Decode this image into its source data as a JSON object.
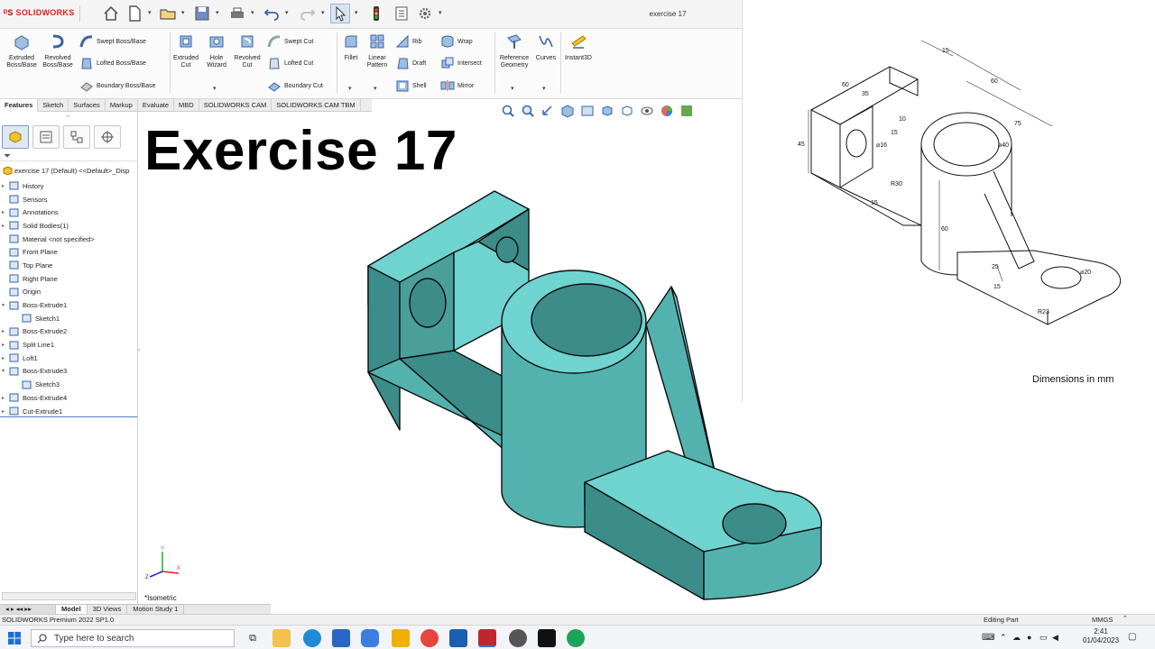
{
  "app": {
    "logo": "SOLIDWORKS",
    "doc_title": "exercise 17"
  },
  "ribbon": {
    "features": [
      {
        "label": "Extruded\nBoss/Base",
        "icon": "extruded-boss-icon"
      },
      {
        "label": "Revolved\nBoss/Base",
        "icon": "revolved-boss-icon"
      },
      {
        "label": "Extruded\nCut",
        "icon": "extruded-cut-icon"
      },
      {
        "label": "Hole\nWizard",
        "icon": "hole-wizard-icon"
      },
      {
        "label": "Revolved\nCut",
        "icon": "revolved-cut-icon"
      },
      {
        "label": "Fillet",
        "icon": "fillet-icon"
      },
      {
        "label": "Linear\nPattern",
        "icon": "linear-pattern-icon"
      },
      {
        "label": "Reference\nGeometry",
        "icon": "reference-geometry-icon"
      },
      {
        "label": "Curves",
        "icon": "curves-icon"
      },
      {
        "label": "Instant3D",
        "icon": "instant3d-icon"
      }
    ],
    "small": {
      "swept_boss": "Swept Boss/Base",
      "lofted_boss": "Lofted Boss/Base",
      "boundary_boss": "Boundary Boss/Base",
      "swept_cut": "Swept Cut",
      "lofted_cut": "Lofted Cut",
      "boundary_cut": "Boundary Cut",
      "rib": "Rib",
      "draft": "Draft",
      "shell": "Shell",
      "wrap": "Wrap",
      "intersect": "Intersect",
      "mirror": "Mirror"
    }
  },
  "tabs": [
    "Features",
    "Sketch",
    "Surfaces",
    "Markup",
    "Evaluate",
    "MBD",
    "SOLIDWORKS CAM",
    "SOLIDWORKS CAM TBM"
  ],
  "tree": {
    "root": "exercise 17 (Default) <<Default>_Disp",
    "items": [
      {
        "label": "History",
        "exp": "▸",
        "indent": 0
      },
      {
        "label": "Sensors",
        "exp": "",
        "indent": 0
      },
      {
        "label": "Annotations",
        "exp": "▸",
        "indent": 0
      },
      {
        "label": "Solid Bodies(1)",
        "exp": "▸",
        "indent": 0
      },
      {
        "label": "Material <not specified>",
        "exp": "",
        "indent": 0
      },
      {
        "label": "Front Plane",
        "exp": "",
        "indent": 0
      },
      {
        "label": "Top Plane",
        "exp": "",
        "indent": 0
      },
      {
        "label": "Right Plane",
        "exp": "",
        "indent": 0
      },
      {
        "label": "Origin",
        "exp": "",
        "indent": 0
      },
      {
        "label": "Boss-Extrude1",
        "exp": "▾",
        "indent": 0
      },
      {
        "label": "Sketch1",
        "exp": "",
        "indent": 1
      },
      {
        "label": "Boss-Extrude2",
        "exp": "▸",
        "indent": 0
      },
      {
        "label": "Split Line1",
        "exp": "▸",
        "indent": 0
      },
      {
        "label": "Loft1",
        "exp": "▸",
        "indent": 0
      },
      {
        "label": "Boss-Extrude3",
        "exp": "▾",
        "indent": 0
      },
      {
        "label": "Sketch3",
        "exp": "",
        "indent": 1
      },
      {
        "label": "Boss-Extrude4",
        "exp": "▸",
        "indent": 0
      },
      {
        "label": "Cut-Extrude1",
        "exp": "▸",
        "indent": 0
      }
    ]
  },
  "bottom_tabs": [
    "Model",
    "3D Views",
    "Motion Study 1"
  ],
  "viewport": {
    "headline": "Exercise 17",
    "view_label": "*Isometric"
  },
  "drawing": {
    "note": "Dimensions in mm",
    "dims": [
      "15",
      "60",
      "35",
      "60",
      "10",
      "75",
      "45",
      "15",
      "⌀16",
      "⌀40",
      "R30",
      "15",
      "60",
      "25",
      "15",
      "⌀20",
      "R23"
    ]
  },
  "status": {
    "left": "SOLIDWORKS Premium 2022 SP1.0",
    "mode": "Editing Part",
    "units": "MMGS"
  },
  "taskbar": {
    "search_placeholder": "Type here to search",
    "time": "2:41",
    "date": "01/04/2023"
  },
  "colors": {
    "model_face": "#6fd3cf",
    "model_dark": "#3c8d89",
    "model_mid": "#53b2ae"
  }
}
